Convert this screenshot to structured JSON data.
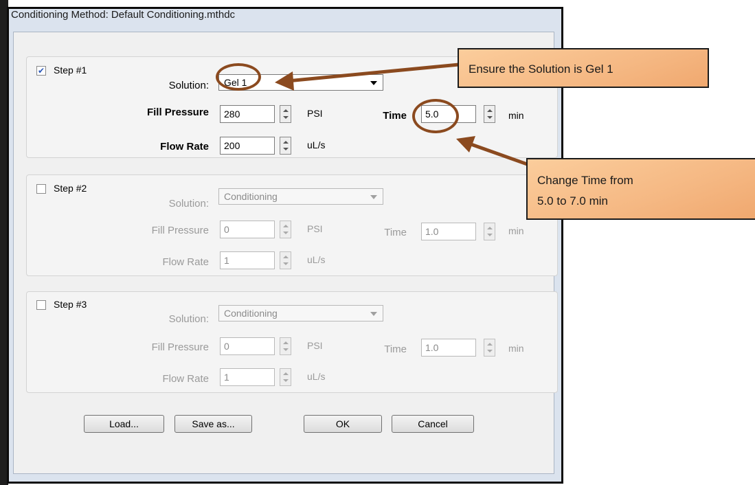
{
  "dialog": {
    "title": "Conditioning Method: Default Conditioning.mthdc"
  },
  "steps": [
    {
      "label": "Step #1",
      "checked": true,
      "enabled": true,
      "solution_label": "Solution:",
      "solution_value": "Gel 1",
      "fill_pressure_label": "Fill Pressure",
      "fill_pressure_value": "280",
      "fill_pressure_unit": "PSI",
      "time_label": "Time",
      "time_value": "5.0",
      "time_unit": "min",
      "flow_rate_label": "Flow Rate",
      "flow_rate_value": "200",
      "flow_rate_unit": "uL/s"
    },
    {
      "label": "Step #2",
      "checked": false,
      "enabled": false,
      "solution_label": "Solution:",
      "solution_value": "Conditioning",
      "fill_pressure_label": "Fill Pressure",
      "fill_pressure_value": "0",
      "fill_pressure_unit": "PSI",
      "time_label": "Time",
      "time_value": "1.0",
      "time_unit": "min",
      "flow_rate_label": "Flow Rate",
      "flow_rate_value": "1",
      "flow_rate_unit": "uL/s"
    },
    {
      "label": "Step #3",
      "checked": false,
      "enabled": false,
      "solution_label": "Solution:",
      "solution_value": "Conditioning",
      "fill_pressure_label": "Fill Pressure",
      "fill_pressure_value": "0",
      "fill_pressure_unit": "PSI",
      "time_label": "Time",
      "time_value": "1.0",
      "time_unit": "min",
      "flow_rate_label": "Flow Rate",
      "flow_rate_value": "1",
      "flow_rate_unit": "uL/s"
    }
  ],
  "buttons": {
    "load": "Load...",
    "save_as": "Save as...",
    "ok": "OK",
    "cancel": "Cancel"
  },
  "annotations": {
    "solution_callout": "Ensure the Solution is Gel 1",
    "time_callout_line1": "Change Time from",
    "time_callout_line2": "5.0 to 7.0 min",
    "accent_color": "#8b4a1f",
    "callout_color": "#f5b883"
  }
}
